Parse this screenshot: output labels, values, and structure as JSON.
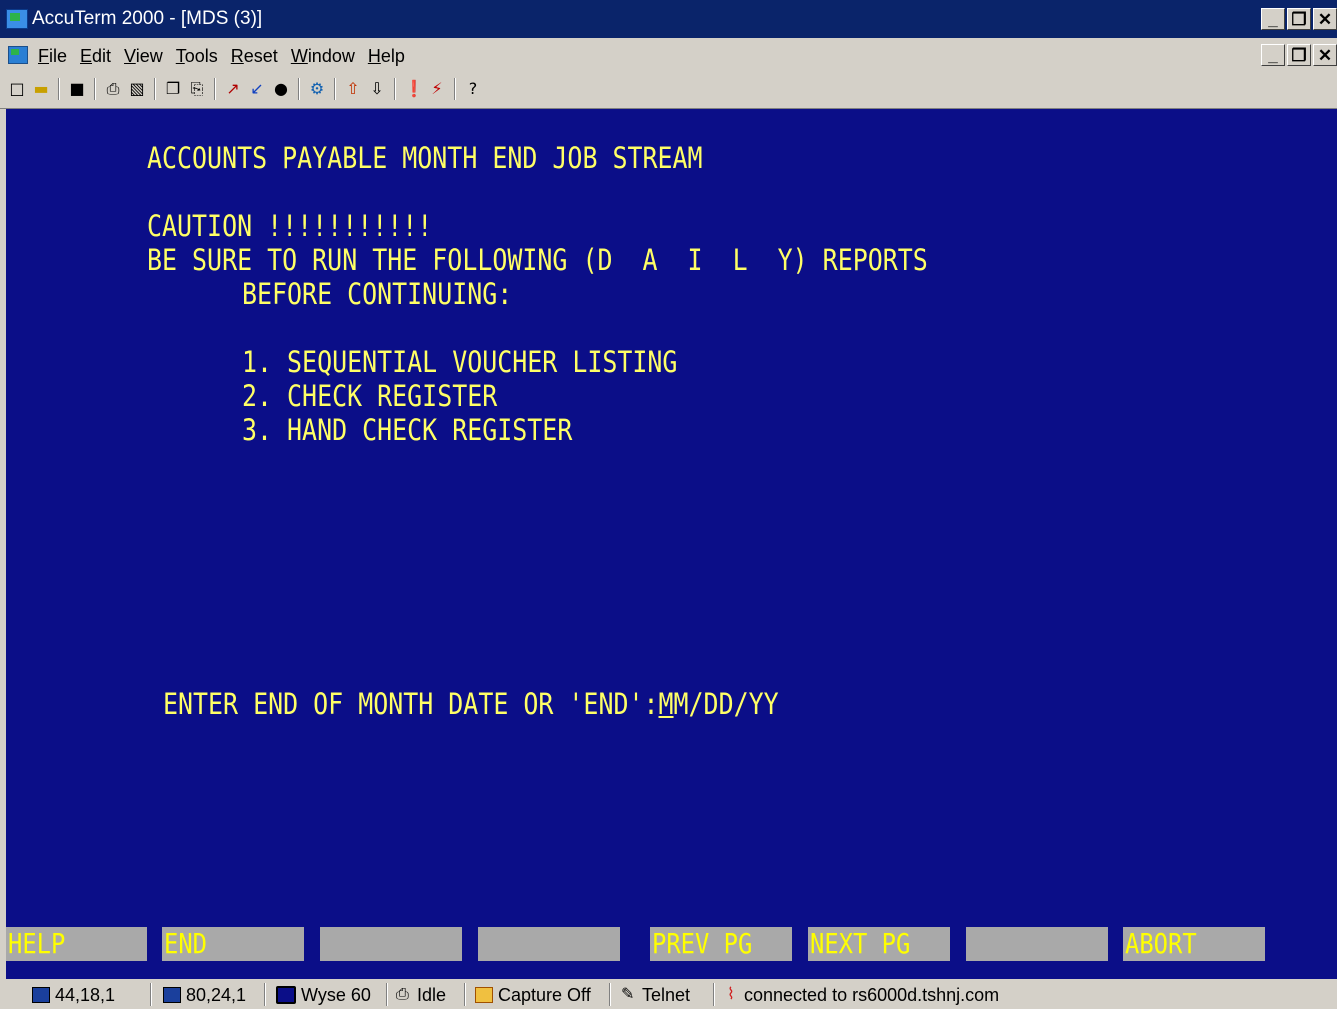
{
  "window": {
    "title": "AccuTerm 2000 - [MDS (3)]"
  },
  "menu": {
    "items": [
      "File",
      "Edit",
      "View",
      "Tools",
      "Reset",
      "Window",
      "Help"
    ]
  },
  "toolbar": {
    "help_glyph": "?"
  },
  "terminal": {
    "heading": "ACCOUNTS PAYABLE MONTH END JOB STREAM",
    "caution": "CAUTION !!!!!!!!!!!",
    "warning_line1": "BE SURE TO RUN THE FOLLOWING (D  A  I  L  Y) REPORTS",
    "warning_line2": "BEFORE CONTINUING:",
    "reports": [
      "1. SEQUENTIAL VOUCHER LISTING",
      "2. CHECK REGISTER",
      "3. HAND CHECK REGISTER"
    ],
    "prompt_label": "ENTER END OF MONTH DATE OR 'END':",
    "prompt_cursor_char": "M",
    "prompt_value_rest": "M/DD/YY"
  },
  "function_keys": [
    "HELP",
    "END",
    "",
    "",
    "PREV PG",
    "NEXT PG",
    "",
    "ABORT"
  ],
  "colors": {
    "terminal_bg": "#0b0e88",
    "terminal_text": "#ffff66",
    "fkey_bg": "#a9a9a9",
    "fkey_text": "#ffff00",
    "titlebar_bg": "#0a246a"
  },
  "status": {
    "cursor_pos": "44,18,1",
    "screen_size": "80,24,1",
    "emulation": "Wyse 60",
    "printer": "Idle",
    "capture": "Capture Off",
    "protocol": "Telnet",
    "connection": "connected to rs6000d.tshnj.com"
  }
}
